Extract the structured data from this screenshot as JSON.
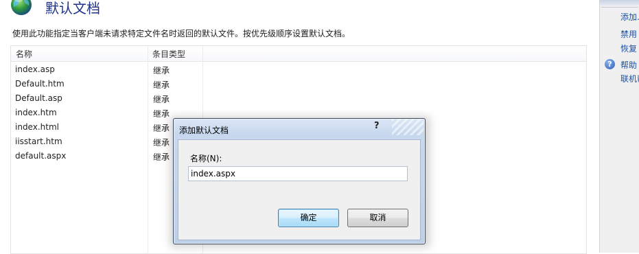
{
  "page": {
    "title": "默认文档",
    "description": "使用此功能指定当客户端未请求特定文件名时返回的默认文件。按优先级顺序设置默认文档。"
  },
  "table": {
    "columns": [
      "名称",
      "条目类型"
    ],
    "rows": [
      {
        "name": "index.asp",
        "type": "继承"
      },
      {
        "name": "Default.htm",
        "type": "继承"
      },
      {
        "name": "Default.asp",
        "type": "继承"
      },
      {
        "name": "index.htm",
        "type": "继承"
      },
      {
        "name": "index.html",
        "type": "继承"
      },
      {
        "name": "iisstart.htm",
        "type": "继承"
      },
      {
        "name": "default.aspx",
        "type": "继承"
      }
    ]
  },
  "actions": {
    "add": "添加...",
    "disable": "禁用",
    "revert": "恢复",
    "help": "帮助",
    "online_help": "联机帮助"
  },
  "dialog": {
    "title": "添加默认文档",
    "help_glyph": "?",
    "name_label": "名称(N):",
    "name_value": "index.aspx",
    "ok_label": "确定",
    "cancel_label": "取消"
  },
  "icons": {
    "header": "globe-document-icon",
    "help": "help-icon"
  }
}
